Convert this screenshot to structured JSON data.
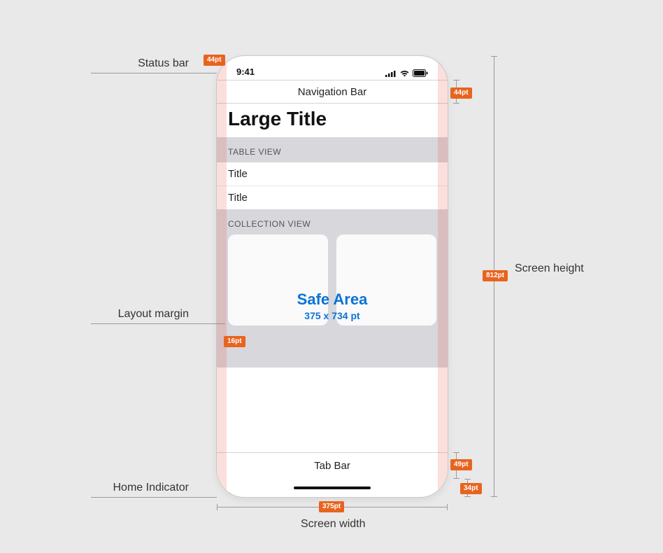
{
  "annotations": {
    "status_bar": "Status bar",
    "layout_margin": "Layout margin",
    "home_indicator": "Home Indicator",
    "screen_height": "Screen height",
    "screen_width": "Screen width"
  },
  "badges": {
    "status_bar_h": "44pt",
    "nav_bar_h": "44pt",
    "layout_margin_w": "16pt",
    "screen_height": "812pt",
    "tab_bar_h": "49pt",
    "home_indicator_h": "34pt",
    "screen_width": "375pt"
  },
  "phone": {
    "status_time": "9:41",
    "nav_bar_title": "Navigation Bar",
    "large_title": "Large Title",
    "table_section_header": "TABLE VIEW",
    "table_rows": [
      "Title",
      "Title"
    ],
    "collection_section_header": "COLLECTION VIEW",
    "tab_bar_title": "Tab Bar"
  },
  "safe_area": {
    "title": "Safe Area",
    "subtitle": "375 x 734 pt"
  }
}
